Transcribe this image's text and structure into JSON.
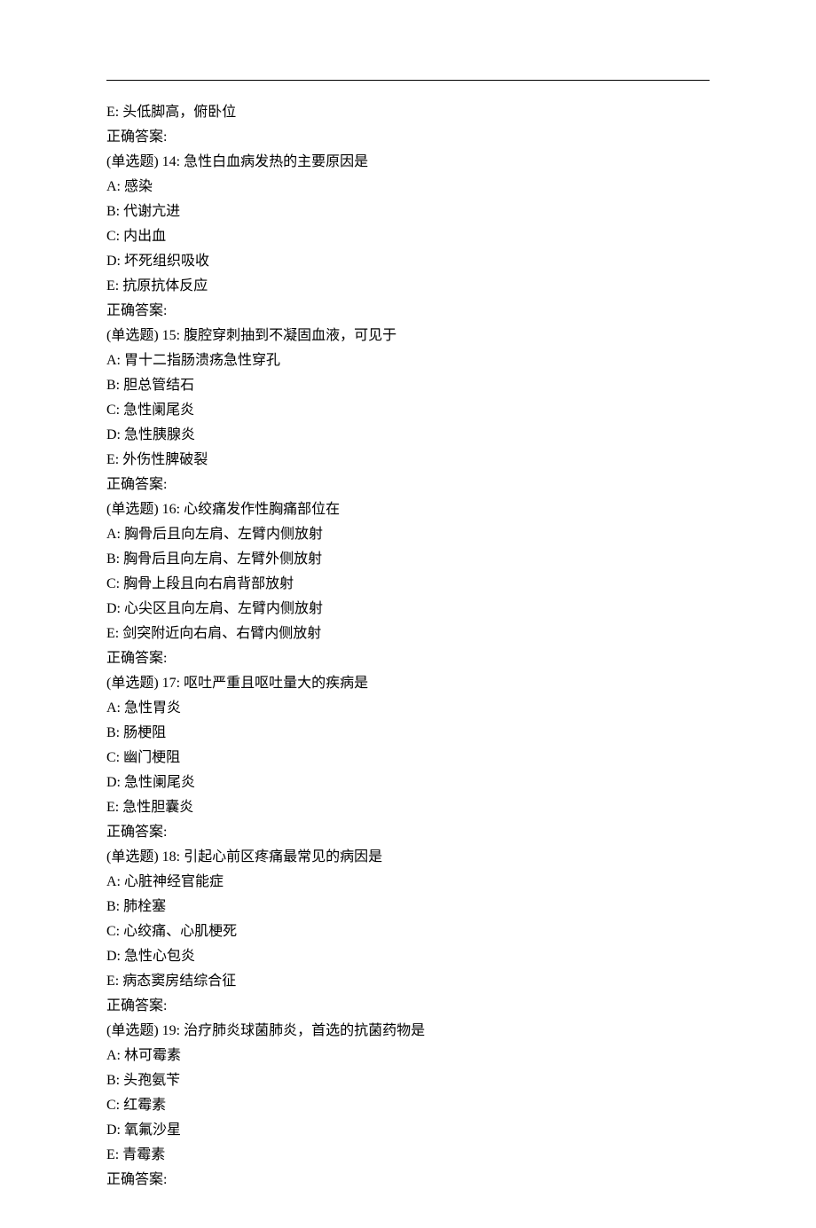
{
  "lines": [
    "E: 头低脚高，俯卧位",
    "正确答案:",
    "(单选题) 14: 急性白血病发热的主要原因是",
    "A: 感染",
    "B: 代谢亢进",
    "C: 内出血",
    "D: 坏死组织吸收",
    "E: 抗原抗体反应",
    "正确答案:",
    "(单选题) 15: 腹腔穿刺抽到不凝固血液，可见于",
    "A: 胃十二指肠溃疡急性穿孔",
    "B: 胆总管结石",
    "C: 急性阑尾炎",
    "D: 急性胰腺炎",
    "E: 外伤性脾破裂",
    "正确答案:",
    "(单选题) 16: 心绞痛发作性胸痛部位在",
    "A: 胸骨后且向左肩、左臂内侧放射",
    "B: 胸骨后且向左肩、左臂外侧放射",
    "C: 胸骨上段且向右肩背部放射",
    "D: 心尖区且向左肩、左臂内侧放射",
    "E: 剑突附近向右肩、右臂内侧放射",
    "正确答案:",
    "(单选题) 17: 呕吐严重且呕吐量大的疾病是",
    "A: 急性胃炎",
    "B: 肠梗阻",
    "C: 幽门梗阻",
    "D: 急性阑尾炎",
    "E: 急性胆囊炎",
    "正确答案:",
    "(单选题) 18: 引起心前区疼痛最常见的病因是",
    "A: 心脏神经官能症",
    "B: 肺栓塞",
    "C: 心绞痛、心肌梗死",
    "D: 急性心包炎",
    "E: 病态窦房结综合征",
    "正确答案:",
    "(单选题) 19: 治疗肺炎球菌肺炎，首选的抗菌药物是",
    "A: 林可霉素",
    "B: 头孢氨苄",
    "C: 红霉素",
    "D: 氧氟沙星",
    "E: 青霉素",
    "正确答案:"
  ]
}
